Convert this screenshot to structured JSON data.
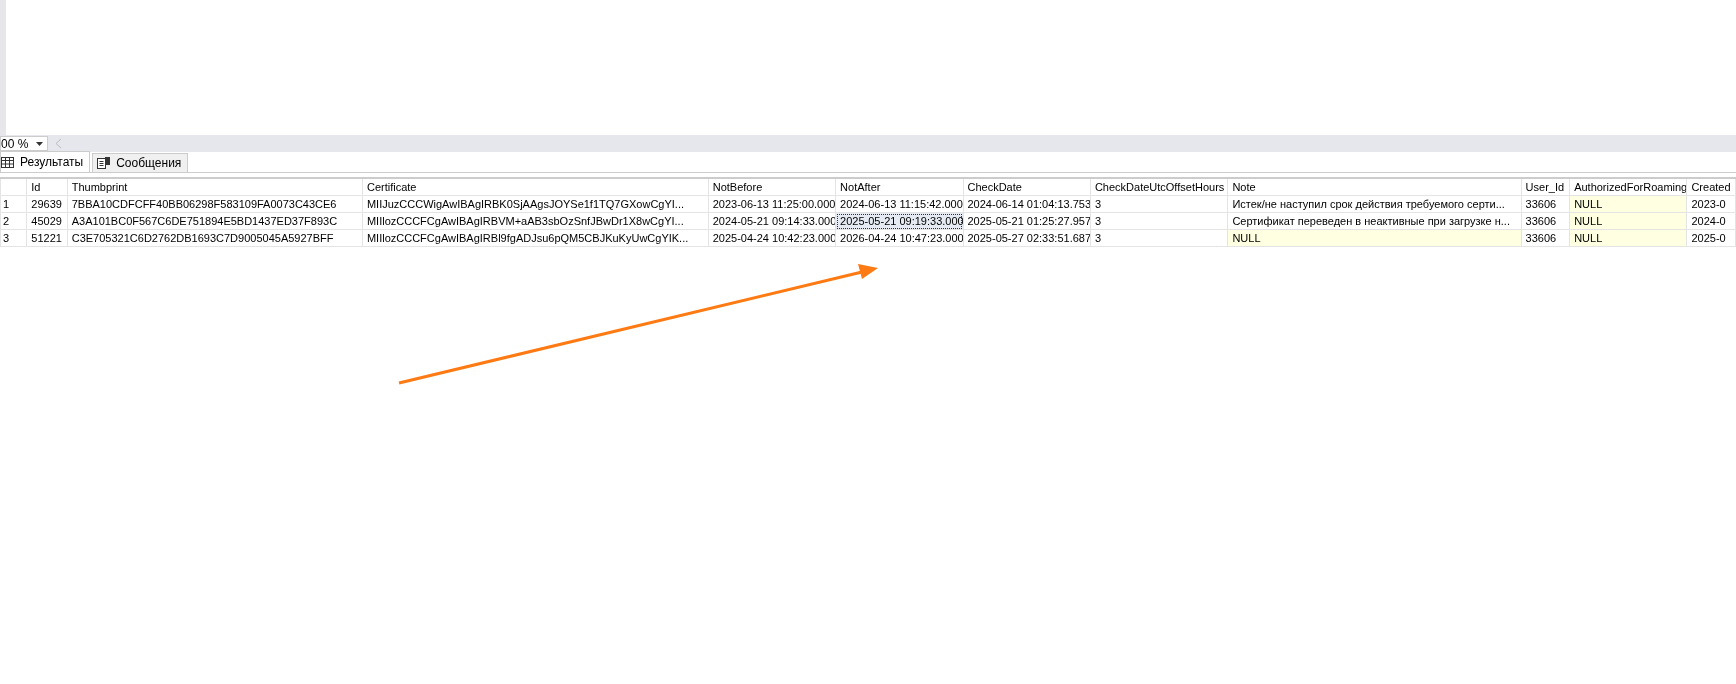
{
  "zoom_control": {
    "value": "00 %"
  },
  "tabs": [
    {
      "label": "Результаты",
      "kind": "grid",
      "selected": true
    },
    {
      "label": "Сообщения",
      "kind": "messages",
      "selected": false
    }
  ],
  "grid": {
    "columns": [
      "Id",
      "Thumbprint",
      "Certificate",
      "NotBefore",
      "NotAfter",
      "CheckDate",
      "CheckDateUtcOffsetHours",
      "Note",
      "User_Id",
      "AuthorizedForRoaming",
      "Created"
    ],
    "rows": [
      {
        "number": "1",
        "cells": [
          {
            "value": "29639",
            "null": false,
            "selected": false
          },
          {
            "value": "7BBA10CDFCFF40BB06298F583109FA0073C43CE6",
            "null": false,
            "selected": false
          },
          {
            "value": "MIIJuzCCCWigAwIBAgIRBK0SjAAgsJOYSe1f1TQ7GXowCgYI...",
            "null": false,
            "selected": false
          },
          {
            "value": "2023-06-13 11:25:00.000",
            "null": false,
            "selected": false
          },
          {
            "value": "2024-06-13 11:15:42.000",
            "null": false,
            "selected": false
          },
          {
            "value": "2024-06-14 01:04:13.753",
            "null": false,
            "selected": false
          },
          {
            "value": "3",
            "null": false,
            "selected": false
          },
          {
            "value": "Истек/не наступил срок действия требуемого серти...",
            "null": false,
            "selected": false
          },
          {
            "value": "33606",
            "null": false,
            "selected": false
          },
          {
            "value": "NULL",
            "null": true,
            "selected": false
          },
          {
            "value": "2023-0",
            "null": false,
            "selected": false
          }
        ]
      },
      {
        "number": "2",
        "cells": [
          {
            "value": "45029",
            "null": false,
            "selected": false
          },
          {
            "value": "A3A101BC0F567C6DE751894E5BD1437ED37F893C",
            "null": false,
            "selected": false
          },
          {
            "value": "MIIlozCCCFCgAwIBAgIRBVM+aAB3sbOzSnfJBwDr1X8wCgYI...",
            "null": false,
            "selected": false
          },
          {
            "value": "2024-05-21 09:14:33.000",
            "null": false,
            "selected": false
          },
          {
            "value": "2025-05-21 09:19:33.000",
            "null": false,
            "selected": true
          },
          {
            "value": "2025-05-21 01:25:27.957",
            "null": false,
            "selected": false
          },
          {
            "value": "3",
            "null": false,
            "selected": false
          },
          {
            "value": "Сертификат переведен в неактивные при загрузке н...",
            "null": false,
            "selected": false
          },
          {
            "value": "33606",
            "null": false,
            "selected": false
          },
          {
            "value": "NULL",
            "null": true,
            "selected": false
          },
          {
            "value": "2024-0",
            "null": false,
            "selected": false
          }
        ]
      },
      {
        "number": "3",
        "cells": [
          {
            "value": "51221",
            "null": false,
            "selected": false
          },
          {
            "value": "C3E705321C6D2762DB1693C7D9005045A5927BFF",
            "null": false,
            "selected": false
          },
          {
            "value": "MIIlozCCCFCgAwIBAgIRBl9fgADJsu6pQM5CBJKuKyUwCgYIK...",
            "null": false,
            "selected": false
          },
          {
            "value": "2025-04-24 10:42:23.000",
            "null": false,
            "selected": false
          },
          {
            "value": "2026-04-24 10:47:23.000",
            "null": false,
            "selected": false
          },
          {
            "value": "2025-05-27 02:33:51.687",
            "null": false,
            "selected": false
          },
          {
            "value": "3",
            "null": false,
            "selected": false
          },
          {
            "value": "NULL",
            "null": true,
            "selected": false
          },
          {
            "value": "33606",
            "null": false,
            "selected": false
          },
          {
            "value": "NULL",
            "null": true,
            "selected": false
          },
          {
            "value": "2025-0",
            "null": false,
            "selected": false
          }
        ]
      }
    ]
  }
}
